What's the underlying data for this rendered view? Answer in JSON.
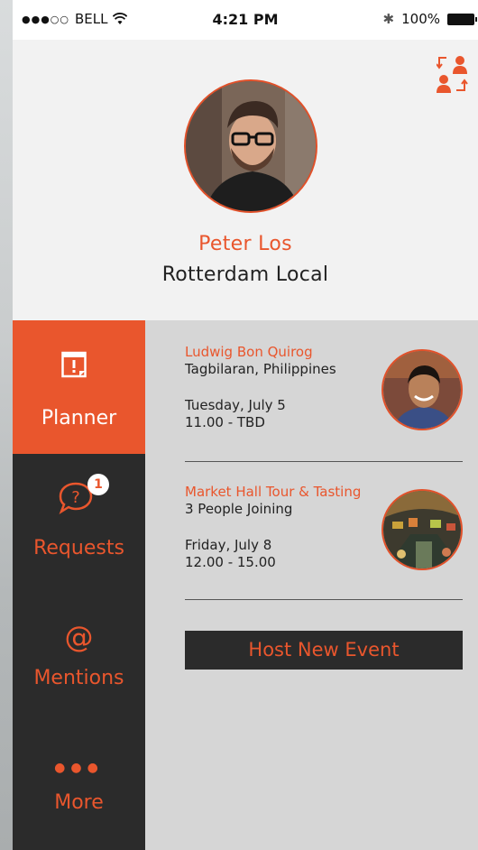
{
  "status_bar": {
    "carrier": "BELL",
    "time": "4:21 PM",
    "battery": "100%"
  },
  "profile": {
    "name": "Peter Los",
    "location": "Rotterdam Local"
  },
  "sidebar": {
    "items": [
      {
        "label": "Planner",
        "icon": "calendar-alert-icon",
        "active": true
      },
      {
        "label": "Requests",
        "icon": "question-bubble-icon",
        "badge": "1"
      },
      {
        "label": "Mentions",
        "icon": "at-sign-icon"
      },
      {
        "label": "More",
        "icon": "dots-icon"
      }
    ]
  },
  "events": [
    {
      "title": "Ludwig Bon Quirog",
      "subtitle": "Tagbilaran, Philippines",
      "date": "Tuesday, July 5",
      "time": "11.00 - TBD"
    },
    {
      "title": "Market Hall Tour & Tasting",
      "subtitle": "3 People Joining",
      "date": "Friday, July 8",
      "time": "12.00 - 15.00"
    }
  ],
  "actions": {
    "host_label": "Host New Event"
  },
  "colors": {
    "accent": "#e9562d",
    "dark": "#2b2b2b",
    "panel": "#d6d6d6"
  }
}
